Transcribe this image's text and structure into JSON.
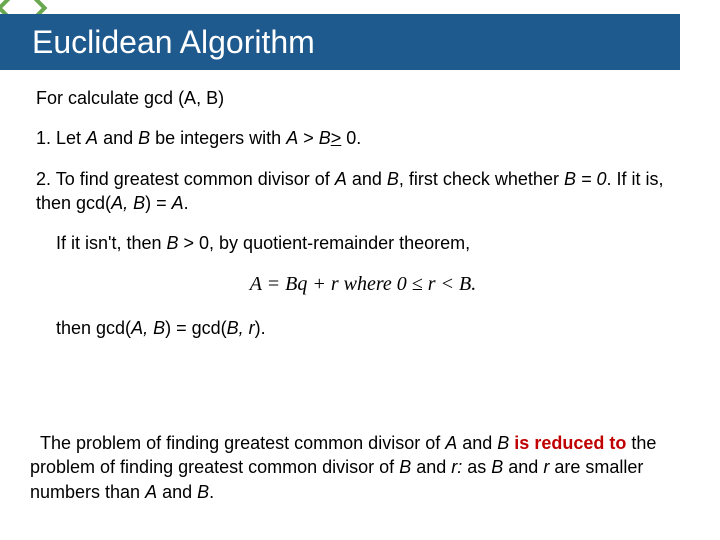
{
  "title": "Euclidean Algorithm",
  "intro": "For calculate gcd (A, B)",
  "step1": {
    "prefix": "1. Let ",
    "A": "A",
    "mid1": " and ",
    "B": "B",
    "mid2": " be integers with ",
    "cond_lhs": "A",
    "gt": " > ",
    "cond_rhs": "B",
    "geq": " >",
    "tail": " 0."
  },
  "step2a": {
    "prefix": "2. To find greatest common divisor of ",
    "A": "A",
    "and": " and ",
    "B": "B",
    "mid": ", first check whether ",
    "eq": "B = 0",
    "mid2": ". If it is, then gcd(",
    "args": "A, B",
    "tail": ") = ",
    "rhs": "A",
    "dot": "."
  },
  "step2b": {
    "prefix": "If it isn't, then ",
    "cond": "B",
    "gt": " > 0, by quotient-remainder theorem,"
  },
  "formula": "A = Bq + r    where 0 ≤ r < B.",
  "step2c": {
    "prefix": "then gcd(",
    "ab": "A, B",
    "mid": ") = gcd(",
    "br": "B, r",
    "tail": ")."
  },
  "conclusion": {
    "p1": "The problem of finding greatest common divisor of ",
    "A": "A",
    "and": " and ",
    "B": "B",
    "is": " is ",
    "reduced": "reduced to",
    "p2": " the problem of finding greatest common divisor of ",
    "B2": "B",
    "and2": " and ",
    "r": "r:",
    "p3": " as ",
    "B3": "B",
    "and3": " and ",
    "r2": "r",
    "p4": " are smaller numbers than ",
    "A2": "A",
    "and4": " and ",
    "B4": "B",
    "dot": "."
  }
}
